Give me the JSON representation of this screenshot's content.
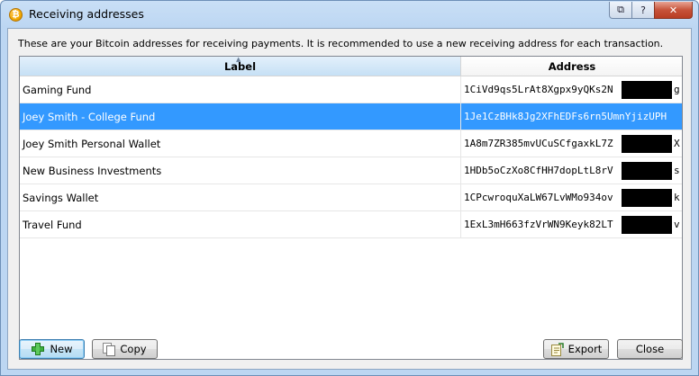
{
  "window": {
    "title": "Receiving addresses",
    "caption_buttons": {
      "restore": "⧉",
      "help": "?",
      "close": "✕"
    }
  },
  "description": "These are your Bitcoin addresses for receiving payments. It is recommended to use a new receiving address for each transaction.",
  "table": {
    "columns": [
      "Label",
      "Address"
    ],
    "rows": [
      {
        "label": "Gaming Fund",
        "address": "1CiVd9qs5LrAt8Xgpx9yQKs2N",
        "tail": "g",
        "selected": false
      },
      {
        "label": "Joey Smith - College Fund",
        "address": "1Je1CzBHk8Jg2XFhEDFs6rn5UmnYjizUPH",
        "tail": "",
        "selected": true
      },
      {
        "label": "Joey Smith Personal Wallet",
        "address": "1A8m7ZR385mvUCuSCfgaxkL7Z",
        "tail": "X",
        "selected": false
      },
      {
        "label": "New Business Investments",
        "address": "1HDb5oCzXo8CfHH7dopLtL8rV",
        "tail": "s",
        "selected": false
      },
      {
        "label": "Savings Wallet",
        "address": "1CPcwroquXaLW67LvWMo934ov",
        "tail": "k",
        "selected": false
      },
      {
        "label": "Travel Fund",
        "address": "1ExL3mH663fzVrWN9Keyk82LT",
        "tail": "v",
        "selected": false
      }
    ]
  },
  "buttons": {
    "new": "New",
    "copy": "Copy",
    "export": "Export",
    "close": "Close"
  },
  "colors": {
    "selection": "#3399ff",
    "title_bar": "#bcd6f2"
  }
}
